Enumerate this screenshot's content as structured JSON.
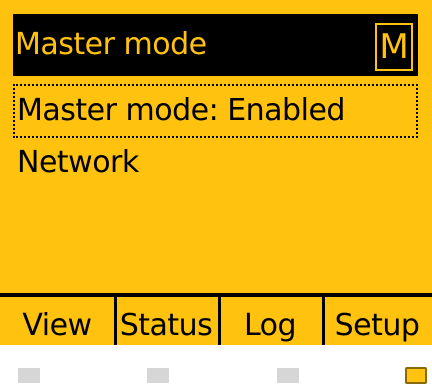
{
  "screen": {
    "title": "Master mode",
    "mode_badge": "M",
    "menu_items": [
      {
        "label": "Master mode: Enabled",
        "selected": true
      },
      {
        "label": "Network",
        "selected": false
      }
    ]
  },
  "softkeys": [
    {
      "label": "View"
    },
    {
      "label": "Status"
    },
    {
      "label": "Log"
    },
    {
      "label": "Setup"
    }
  ],
  "leds": [
    {
      "state": "off",
      "color": "#d6d6d6"
    },
    {
      "state": "off",
      "color": "#d6d6d6"
    },
    {
      "state": "off",
      "color": "#d6d6d6"
    },
    {
      "state": "on",
      "color": "#ffc20e"
    }
  ],
  "colors": {
    "display_background": "#ffc20e",
    "title_bar": "#000000",
    "text": "#000000"
  }
}
